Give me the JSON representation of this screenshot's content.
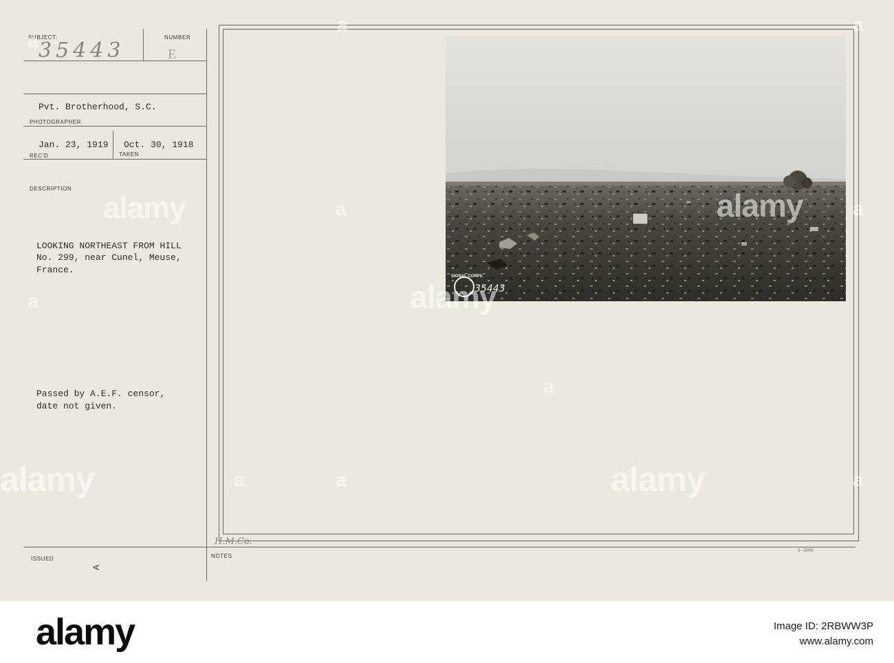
{
  "card": {
    "subject_label": "SUBJECT:",
    "subject_value": "35443",
    "number_label": "NUMBER",
    "number_value": "E",
    "photographer_value": "Pvt. Brotherhood, S.C.",
    "photographer_label": "PHOTOGRAPHER",
    "received_value": "Jan. 23, 1919",
    "received_label": "REC'D",
    "taken_value": "Oct. 30, 1918",
    "taken_label": "TAKEN",
    "description_label": "DESCRIPTION",
    "description_lines": [
      "LOOKING NORTHEAST FROM HILL",
      "No. 299, near Cunel, Meuse,",
      "France."
    ],
    "censor_lines": [
      "Passed by A.E.F. censor,",
      "date not given."
    ],
    "issued_label": "ISSUED",
    "issued_mark": "A",
    "notes_label": "NOTES",
    "notes_handwriting": "H.M.Co.",
    "form_code": "3—5005",
    "photo_stamp_text": "SIGNAL CORPS",
    "photo_number": "35443"
  },
  "watermark": {
    "text": "alamy"
  },
  "footer": {
    "logo": "alamy",
    "image_id": "Image ID: 2RBWW3P",
    "url": "www.alamy.com"
  },
  "colors": {
    "card_background": "#ede8dd",
    "ink": "#2e2b28",
    "footer_background": "#ffffff"
  }
}
